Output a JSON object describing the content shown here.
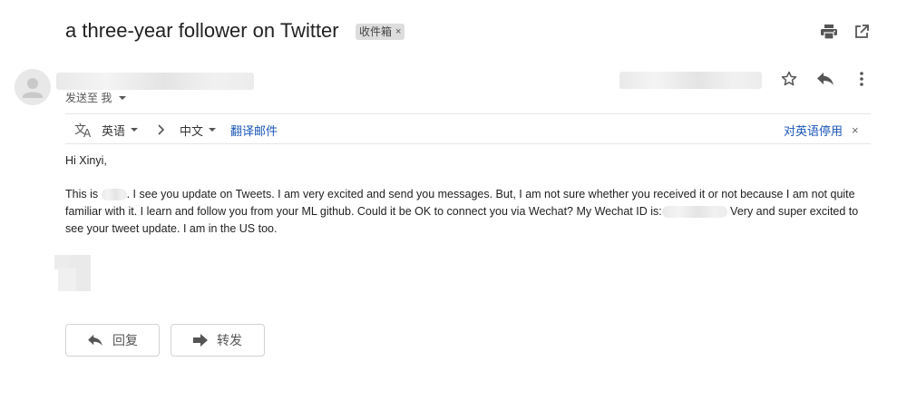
{
  "email": {
    "subject": "a three-year follower on Twitter",
    "label": "收件箱",
    "label_remove": "×",
    "sent_to_label": "发送至 我",
    "greeting": "Hi Xinyi,",
    "body": {
      "p1_start": "This is",
      "p1_after_name": ". I see you update on Tweets. I am very excited and send you messages. But, I am not sure whether you received it  or not because I am not quite familiar with it. I learn and follow you from your ML github. Could it be OK to connect you via Wechat? My Wechat ID is:",
      "p1_end": " Very and super excited to see your tweet update. I am in the US too."
    }
  },
  "translate_bar": {
    "source_lang": "英语",
    "target_lang": "中文",
    "translate_link": "翻译邮件",
    "disable_link": "对英语停用",
    "close": "×"
  },
  "actions": {
    "reply": "回复",
    "forward": "转发"
  },
  "icons": {
    "print": "print-icon",
    "open_new_window": "open-in-new-icon",
    "star": "star-icon",
    "reply": "reply-icon",
    "more": "more-vert-icon",
    "translate": "translate-icon",
    "forward": "forward-icon"
  }
}
